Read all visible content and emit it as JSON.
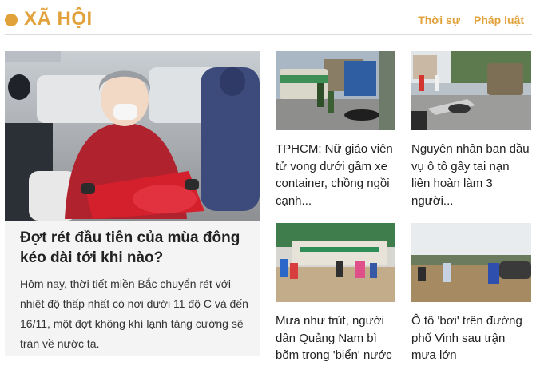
{
  "section": {
    "title": "XÃ HỘI",
    "links": [
      "Thời sự",
      "Pháp luật"
    ]
  },
  "featured": {
    "title": "Đợt rét đầu tiên của mùa đông kéo dài tới khi nào?",
    "description": "Hôm nay, thời tiết miền Bắc chuyển rét với nhiệt độ thấp nhất có nơi dưới 11 độ C và đến 16/11, một đợt không khí lạnh tăng cường sẽ tràn về nước ta."
  },
  "articles": [
    {
      "title": "TPHCM: Nữ giáo viên tử vong dưới gầm xe container, chồng ngồi cạnh..."
    },
    {
      "title": "Nguyên nhân ban đầu vụ ô tô gây tai nạn liên hoàn làm 3 người..."
    },
    {
      "title": "Mưa như trút, người dân Quảng Nam bì bõm trong 'biển' nước"
    },
    {
      "title": "Ô tô 'bơi' trên đường phố Vinh sau trận mưa lớn"
    }
  ],
  "colors": {
    "accent": "#e2a23b",
    "feature_bg": "#f4f4f4"
  }
}
